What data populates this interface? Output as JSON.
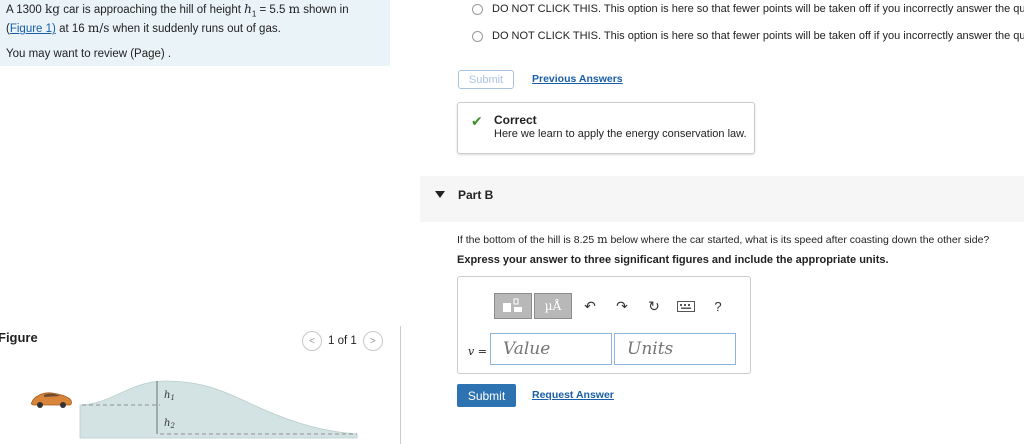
{
  "problem": {
    "text_1": "A 1300",
    "unit_kg": "kg",
    "text_2": "car is approaching the hill of height",
    "var_h1": "h",
    "sub_1": "1",
    "eq_value": "= 5.5",
    "unit_m": "m",
    "text_3": "shown in (",
    "figure_link": "Figure 1)",
    "text_4": "at 16",
    "unit_ms": "m/s",
    "text_5": "when it  suddenly runs out of gas.",
    "review": "You may want to review (Page) ."
  },
  "figure": {
    "label": "Figure",
    "pager": "1 of 1",
    "prev_icon": "chevron-left-icon",
    "next_icon": "chevron-right-icon",
    "h1_label": "h",
    "h1_sub": "1",
    "h2_label": "h",
    "h2_sub": "2"
  },
  "part_a": {
    "option_1": "DO NOT CLICK THIS. This option is here so that fewer points will be taken off if you incorrectly answer the question.",
    "option_2": "DO NOT CLICK THIS. This option is here so that fewer points will be taken off if you incorrectly answer the question.",
    "submit_label": "Submit",
    "previous_answers": "Previous Answers",
    "feedback_title": "Correct",
    "feedback_msg": "Here we learn to apply the energy conservation law."
  },
  "part_b": {
    "label": "Part B",
    "question_1": "If the bottom of the hill is 8.25",
    "question_unit": "m",
    "question_2": "below where the car started, what is its speed after coasting down the other side?",
    "instructions": "Express your answer to three significant figures and include the appropriate units.",
    "toolbar": {
      "units_btn": "µÅ",
      "undo_icon": "undo-icon",
      "redo_icon": "redo-icon",
      "reset_icon": "reset-icon",
      "keyboard_icon": "keyboard-icon",
      "help": "?"
    },
    "var_label": "v =",
    "value_placeholder": "Value",
    "units_placeholder": "Units",
    "submit_label": "Submit",
    "request_answer": "Request Answer"
  },
  "colors": {
    "accent": "#2d73b2",
    "link": "#1a5ea8",
    "correct": "#3b8f2a",
    "problem_bg": "#e9f3f8"
  }
}
